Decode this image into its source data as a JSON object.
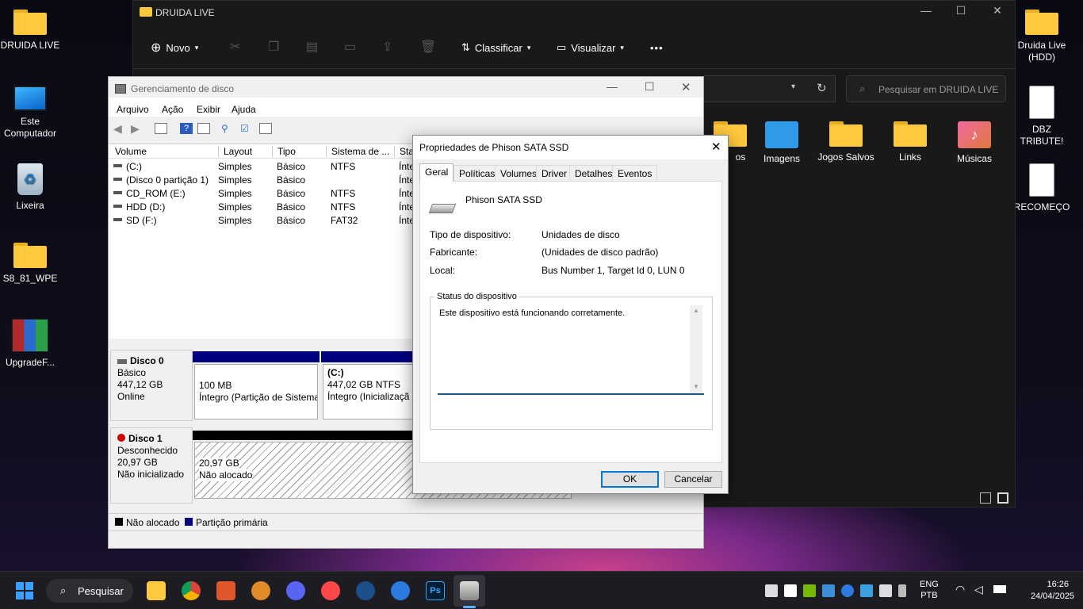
{
  "desktop": {
    "left_icons": [
      {
        "label": "DRUIDA LIVE",
        "icon": "folder-icon"
      },
      {
        "label": "Este Computador",
        "icon": "monitor-icon"
      },
      {
        "label": "Lixeira",
        "icon": "recycle-bin-icon"
      },
      {
        "label": "S8_81_WPE",
        "icon": "folder-icon"
      },
      {
        "label": "UpgradeF...",
        "icon": "winrar-icon"
      }
    ],
    "right_icons": [
      {
        "label": "Druida Live (HDD)",
        "icon": "folder-shortcut-icon"
      },
      {
        "label": "DBZ TRIBUTE!",
        "icon": "document-icon"
      },
      {
        "label": "RECOMEÇO",
        "icon": "document-icon"
      }
    ]
  },
  "explorer": {
    "title": "DRUIDA LIVE",
    "toolbar": {
      "new": "Novo",
      "sort": "Classificar",
      "view": "Visualizar",
      "more": "•••"
    },
    "search_placeholder": "Pesquisar em DRUIDA LIVE",
    "items": [
      {
        "label": "os",
        "icon": "folder-icon"
      },
      {
        "label": "Imagens",
        "icon": "pictures-folder-icon"
      },
      {
        "label": "Jogos Salvos",
        "icon": "folder-icon"
      },
      {
        "label": "Links",
        "icon": "folder-icon"
      },
      {
        "label": "Músicas",
        "icon": "music-folder-icon"
      }
    ]
  },
  "disk_mgmt": {
    "title": "Gerenciamento de disco",
    "menu": [
      "Arquivo",
      "Ação",
      "Exibir",
      "Ajuda"
    ],
    "columns": [
      "Volume",
      "Layout",
      "Tipo",
      "Sistema de ...",
      "Stat"
    ],
    "volumes": [
      {
        "volume": "(C:)",
        "layout": "Simples",
        "tipo": "Básico",
        "fs": "NTFS",
        "status": "Ínte"
      },
      {
        "volume": "(Disco 0 partição 1)",
        "layout": "Simples",
        "tipo": "Básico",
        "fs": "",
        "status": "Ínte"
      },
      {
        "volume": "CD_ROM (E:)",
        "layout": "Simples",
        "tipo": "Básico",
        "fs": "NTFS",
        "status": "Ínte"
      },
      {
        "volume": "HDD (D:)",
        "layout": "Simples",
        "tipo": "Básico",
        "fs": "NTFS",
        "status": "Ínte"
      },
      {
        "volume": "SD (F:)",
        "layout": "Simples",
        "tipo": "Básico",
        "fs": "FAT32",
        "status": "Ínte"
      }
    ],
    "disk0": {
      "name": "Disco 0",
      "type": "Básico",
      "size": "447,12 GB",
      "state": "Online",
      "p1": {
        "size": "100 MB",
        "status": "Íntegro (Partição de Sistema"
      },
      "p2": {
        "label": "(C:)",
        "size": "447,02 GB NTFS",
        "status": "Íntegro (Inicializaçã"
      }
    },
    "disk1": {
      "name": "Disco 1",
      "type": "Desconhecido",
      "size": "20,97 GB",
      "state": "Não inicializado",
      "p1": {
        "size": "20,97 GB",
        "status": "Não alocado"
      }
    },
    "legend": {
      "unallocated": "Não alocado",
      "primary": "Partição primária"
    },
    "colors": {
      "primary": "#000080",
      "unallocated": "#000000"
    }
  },
  "props": {
    "title": "Propriedades de Phison SATA SSD",
    "tabs": [
      "Geral",
      "Políticas",
      "Volumes",
      "Driver",
      "Detalhes",
      "Eventos"
    ],
    "device_name": "Phison SATA SSD",
    "fields": [
      {
        "label": "Tipo de dispositivo:",
        "value": "Unidades de disco"
      },
      {
        "label": "Fabricante:",
        "value": "(Unidades de disco padrão)"
      },
      {
        "label": "Local:",
        "value": "Bus Number 1, Target Id 0, LUN 0"
      }
    ],
    "status_group": "Status do dispositivo",
    "status_text": "Este dispositivo está funcionando corretamente.",
    "ok": "OK",
    "cancel": "Cancelar"
  },
  "taskbar": {
    "search": "Pesquisar",
    "apps": [
      "file-explorer-icon",
      "chrome-icon",
      "app-red-icon",
      "app-orange-icon",
      "discord-icon",
      "ea-icon",
      "steam-icon",
      "app-blue-icon",
      "photoshop-icon",
      "disk-mgmt-icon"
    ],
    "lang": "ENG",
    "layout": "PTB",
    "time": "16:26",
    "date": "24/04/2025"
  }
}
